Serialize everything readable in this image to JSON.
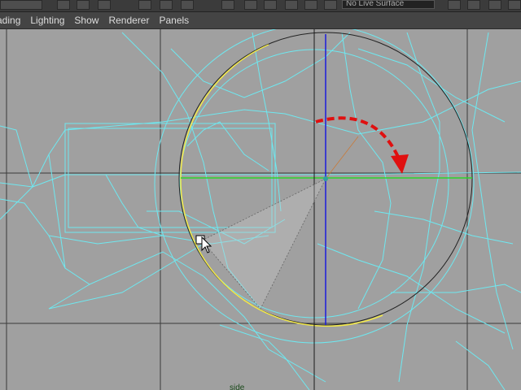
{
  "toolbar": {
    "live_surface_field": "No Live Surface"
  },
  "menubar": {
    "items": [
      "ading",
      "Lighting",
      "Show",
      "Renderer",
      "Panels"
    ]
  },
  "viewport": {
    "camera_label": "side",
    "colors": {
      "background": "#a0a0a0",
      "wireframe": "#6ee8f0",
      "grid": "#3a3a3a",
      "rotate_ring_active": "#f2e84a",
      "rotate_ring_inactive": "#222222",
      "axis_x": "#2bd62b",
      "axis_y": "#1a1adc",
      "annotation_arrow": "#e01010"
    },
    "icons": {
      "cursor": "mouse-pointer-icon",
      "annotation": "curved-arrow-icon"
    }
  }
}
